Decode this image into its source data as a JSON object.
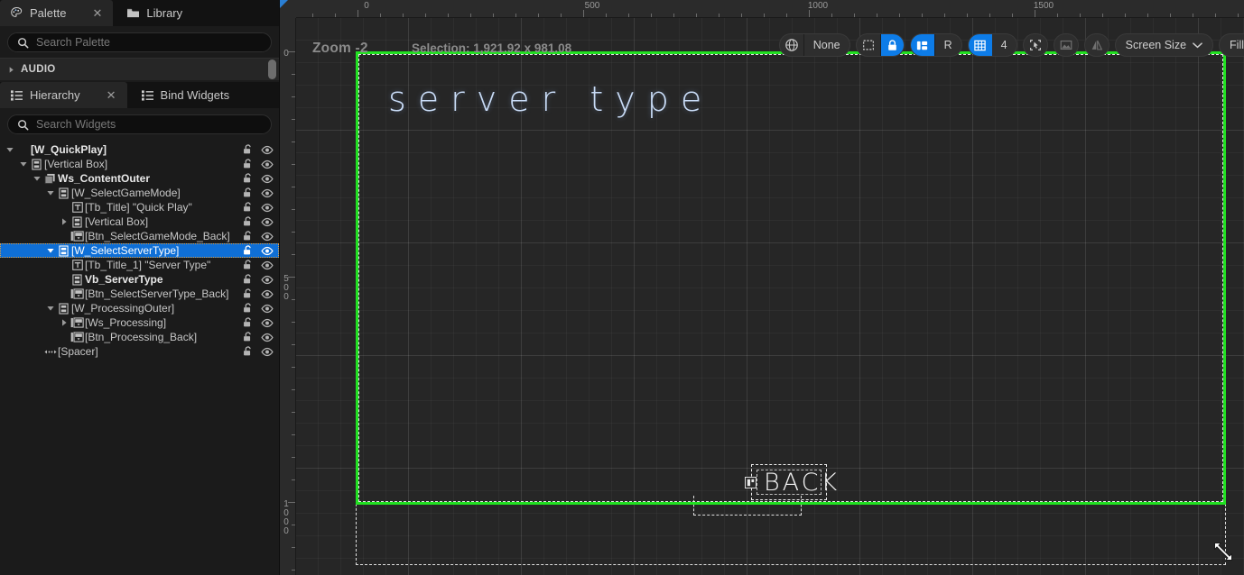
{
  "palette_panel": {
    "tabs": [
      {
        "label": "Palette",
        "icon": "palette-icon",
        "active": true,
        "closable": true
      },
      {
        "label": "Library",
        "icon": "folder-icon",
        "active": false,
        "closable": false
      }
    ],
    "search": {
      "placeholder": "Search Palette",
      "value": "",
      "icon": "search-icon"
    },
    "categories": [
      {
        "label": "AUDIO",
        "expanded": false
      }
    ]
  },
  "hierarchy_panel": {
    "tabs": [
      {
        "label": "Hierarchy",
        "icon": "list-icon",
        "active": true,
        "closable": true
      },
      {
        "label": "Bind Widgets",
        "icon": "list-icon",
        "active": false,
        "closable": false
      }
    ],
    "search": {
      "placeholder": "Search Widgets",
      "value": "",
      "icon": "search-icon"
    },
    "column_icons": {
      "lock": "unlocked-padlock-icon",
      "visibility": "eye-icon"
    },
    "tree": [
      {
        "label": "[W_QuickPlay]",
        "depth": 0,
        "icon": "none",
        "twist": "down",
        "bold": true,
        "selected": false
      },
      {
        "label": "[Vertical Box]",
        "depth": 1,
        "icon": "verticalbox",
        "twist": "down",
        "bold": false,
        "selected": false
      },
      {
        "label": "Ws_ContentOuter",
        "depth": 2,
        "icon": "switcher",
        "twist": "down",
        "bold": true,
        "selected": false
      },
      {
        "label": "[W_SelectGameMode]",
        "depth": 3,
        "icon": "verticalbox",
        "twist": "down",
        "bold": false,
        "selected": false
      },
      {
        "label": "[Tb_Title] \"Quick Play\"",
        "depth": 4,
        "icon": "textblock",
        "twist": "none",
        "bold": false,
        "selected": false
      },
      {
        "label": "[Vertical Box]",
        "depth": 4,
        "icon": "verticalbox",
        "twist": "right",
        "bold": false,
        "selected": false
      },
      {
        "label": "[Btn_SelectGameMode_Back]",
        "depth": 4,
        "icon": "button",
        "twist": "none",
        "bold": false,
        "selected": false
      },
      {
        "label": "[W_SelectServerType]",
        "depth": 3,
        "icon": "verticalbox",
        "twist": "down",
        "bold": false,
        "selected": true
      },
      {
        "label": "[Tb_Title_1] \"Server Type\"",
        "depth": 4,
        "icon": "textblock",
        "twist": "none",
        "bold": false,
        "selected": false
      },
      {
        "label": "Vb_ServerType",
        "depth": 4,
        "icon": "verticalbox",
        "twist": "none",
        "bold": true,
        "selected": false
      },
      {
        "label": "[Btn_SelectServerType_Back]",
        "depth": 4,
        "icon": "button",
        "twist": "none",
        "bold": false,
        "selected": false
      },
      {
        "label": "[W_ProcessingOuter]",
        "depth": 3,
        "icon": "verticalbox",
        "twist": "down",
        "bold": false,
        "selected": false
      },
      {
        "label": "[Ws_Processing]",
        "depth": 4,
        "icon": "button",
        "twist": "right",
        "bold": false,
        "selected": false
      },
      {
        "label": "[Btn_Processing_Back]",
        "depth": 4,
        "icon": "button",
        "twist": "none",
        "bold": false,
        "selected": false
      },
      {
        "label": "[Spacer]",
        "depth": 2,
        "icon": "spacer",
        "twist": "none",
        "bold": false,
        "selected": false
      }
    ]
  },
  "viewport": {
    "zoom_label": "Zoom -2",
    "selection_label": "Selection: 1,921.92 x 981.08",
    "ruler_h_labels": [
      "0",
      "500",
      "1000",
      "1500"
    ],
    "ruler_v_labels": [
      "0",
      "500",
      "1000"
    ],
    "toolbar": {
      "localization": {
        "icon": "globe-icon",
        "value": "None"
      },
      "dashed_outlines": {
        "icon": "dashed-rect-icon",
        "active": false
      },
      "lock_widget": {
        "icon": "padlock-icon",
        "active": true
      },
      "layout_guides": {
        "icon": "layout-icon",
        "active": true
      },
      "respect_locks": {
        "label": "R",
        "active": false
      },
      "grid_snap": {
        "icon": "grid-icon",
        "active": true,
        "value": "4"
      },
      "snap_to_widget": {
        "icon": "cursor-bracket-icon",
        "active": false
      },
      "image_preview": {
        "icon": "image-icon",
        "active": false
      },
      "mirror": {
        "icon": "mirror-icon",
        "active": false
      },
      "screen_size": {
        "label": "Screen Size",
        "icon": "chevron-down-icon"
      },
      "fill_screen": {
        "label": "Fill"
      }
    },
    "selection_color": "#22e022",
    "canvas": {
      "title_text": "server type",
      "title_color": "#c9dcf7",
      "back_button_text": "BACK"
    }
  }
}
